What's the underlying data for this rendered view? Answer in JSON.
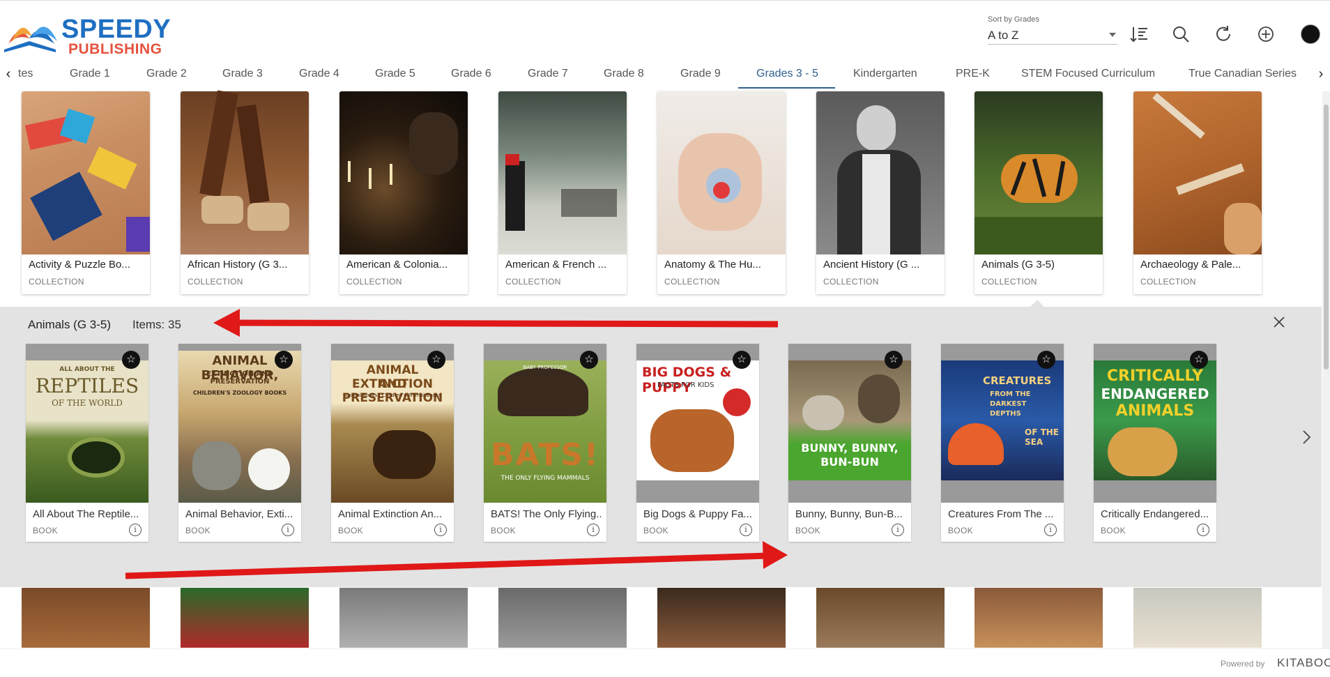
{
  "brand": {
    "name_line1": "SPEEDY",
    "name_line2": "PUBLISHING"
  },
  "sort": {
    "label": "Sort by Grades",
    "value": "A to Z"
  },
  "header_icons": [
    "sort-order-icon",
    "search-icon",
    "refresh-icon",
    "add-icon",
    "avatar"
  ],
  "tabs": [
    {
      "label": "tes"
    },
    {
      "label": "Grade 1"
    },
    {
      "label": "Grade 2"
    },
    {
      "label": "Grade 3"
    },
    {
      "label": "Grade 4"
    },
    {
      "label": "Grade 5"
    },
    {
      "label": "Grade 6"
    },
    {
      "label": "Grade 7"
    },
    {
      "label": "Grade 8"
    },
    {
      "label": "Grade 9"
    },
    {
      "label": "Grades 3 - 5"
    },
    {
      "label": "Kindergarten"
    },
    {
      "label": "PRE-K"
    },
    {
      "label": "STEM Focused Curriculum"
    },
    {
      "label": "True Canadian Series"
    }
  ],
  "active_tab": "Grades 3 - 5",
  "collections": [
    {
      "title": "Activity & Puzzle Bo...",
      "type": "COLLECTION"
    },
    {
      "title": "African History (G 3...",
      "type": "COLLECTION"
    },
    {
      "title": "American & Colonia...",
      "type": "COLLECTION"
    },
    {
      "title": "American & French ...",
      "type": "COLLECTION"
    },
    {
      "title": "Anatomy & The Hu...",
      "type": "COLLECTION"
    },
    {
      "title": "Ancient History (G ...",
      "type": "COLLECTION"
    },
    {
      "title": "Animals (G 3-5)",
      "type": "COLLECTION"
    },
    {
      "title": "Archaeology & Pale...",
      "type": "COLLECTION"
    }
  ],
  "panel": {
    "title": "Animals (G 3-5)",
    "count": "Items: 35"
  },
  "books": [
    {
      "title": "All About The Reptile...",
      "type": "BOOK",
      "cover": [
        "ALL ABOUT THE",
        "REPTILES",
        "OF THE WORLD"
      ]
    },
    {
      "title": "Animal Behavior, Exti...",
      "type": "BOOK",
      "cover": [
        "ANIMAL BEHAVIOR,",
        "EXTINCTION AND PRESERVATION",
        "CHILDREN'S ZOOLOGY BOOKS"
      ]
    },
    {
      "title": "Animal Extinction An...",
      "type": "BOOK",
      "cover": [
        "ANIMAL EXTINCTION",
        "AND PRESERVATION",
        "Animal Books | Children's Animal Books"
      ]
    },
    {
      "title": "BATS! The Only Flying...",
      "type": "BOOK",
      "cover": [
        "BABY PROFESSOR",
        "BATS!",
        "THE ONLY FLYING MAMMALS"
      ]
    },
    {
      "title": "Big Dogs & Puppy Fa...",
      "type": "BOOK",
      "cover": [
        "BIG DOGS & PUPPY",
        "FACTS FOR KIDS",
        ""
      ]
    },
    {
      "title": "Bunny, Bunny, Bun-B...",
      "type": "BOOK",
      "cover": [
        "",
        "BUNNY, BUNNY,",
        "BUN-BUN"
      ]
    },
    {
      "title": "Creatures From The ...",
      "type": "BOOK",
      "cover": [
        "CREATURES",
        "FROM THE DARKEST DEPTHS",
        "OF THE SEA"
      ]
    },
    {
      "title": "Critically Endangered...",
      "type": "BOOK",
      "cover": [
        "CRITICALLY",
        "ENDANGERED",
        "ANIMALS"
      ]
    }
  ],
  "footer": {
    "powered": "Powered by",
    "vendor": "KITABOO"
  }
}
